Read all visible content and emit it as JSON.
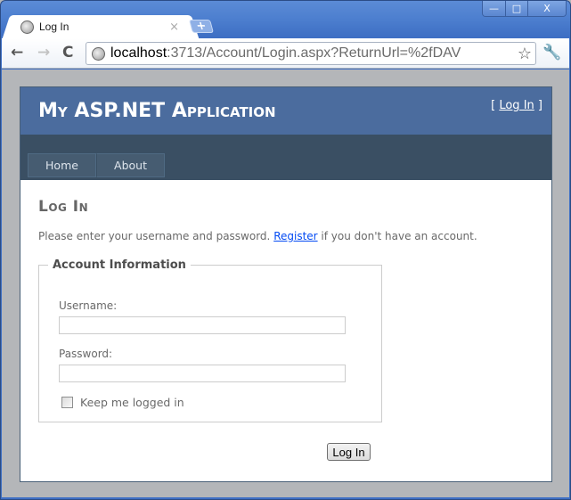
{
  "window": {
    "controls": {
      "minimize": "—",
      "maximize": "□",
      "close": "X"
    }
  },
  "tabs": [
    {
      "title": "Log In",
      "icon": "globe-icon",
      "close": "×"
    }
  ],
  "new_tab": "+",
  "toolbar": {
    "back": "←",
    "forward": "→",
    "reload": "C",
    "url_host": "localhost",
    "url_rest": ":3713/Account/Login.aspx?ReturnUrl=%2fDAV",
    "star": "☆",
    "wrench": "🔧"
  },
  "site": {
    "title": "My ASP.NET Application",
    "login_prefix": "[ ",
    "login_link": "Log In",
    "login_suffix": " ]",
    "menu": [
      "Home",
      "About"
    ]
  },
  "main": {
    "heading": "Log In",
    "intro_before": "Please enter your username and password. ",
    "register_link": "Register",
    "intro_after": " if you don't have an account.",
    "fieldset_legend": "Account Information",
    "username_label": "Username:",
    "username_value": "",
    "password_label": "Password:",
    "password_value": "",
    "remember_label": "Keep me logged in",
    "remember_checked": false,
    "submit_label": "Log In"
  },
  "colors": {
    "header": "#4b6c9e",
    "menubar": "#3a4f63",
    "menu_item": "#465c71",
    "link": "#034af3"
  }
}
